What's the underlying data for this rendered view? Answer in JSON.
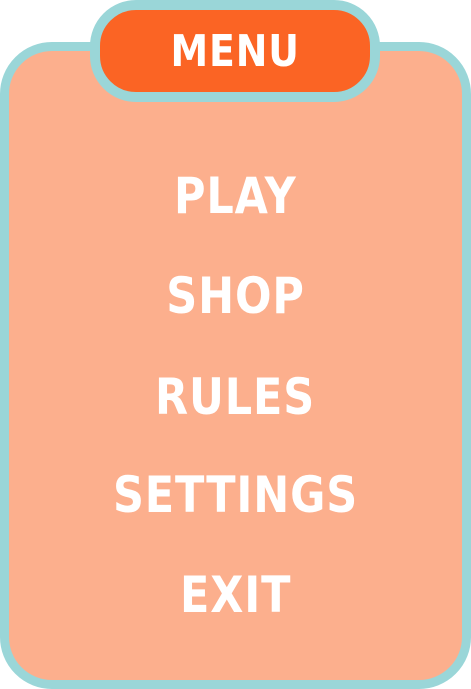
{
  "menu": {
    "title": "MENU",
    "items": [
      {
        "label": "PLAY"
      },
      {
        "label": "SHOP"
      },
      {
        "label": "RULES"
      },
      {
        "label": "SETTINGS"
      },
      {
        "label": "EXIT"
      }
    ]
  },
  "colors": {
    "panel": "#fcaf8d",
    "title_tab": "#fb6424",
    "border": "#9ad6d8",
    "text": "#ffffff"
  }
}
